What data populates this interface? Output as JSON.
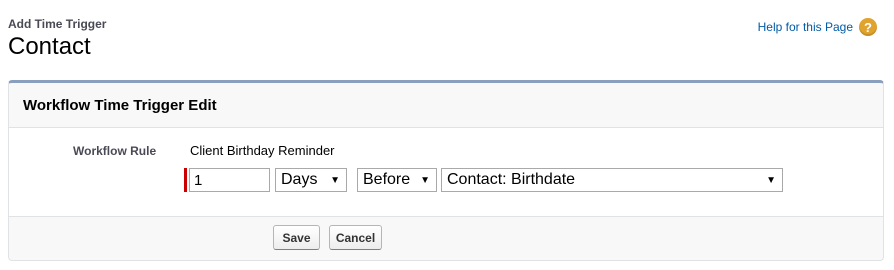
{
  "header": {
    "subtitle": "Add Time Trigger",
    "title": "Contact"
  },
  "help": {
    "link_label": "Help for this Page",
    "icon_glyph": "?",
    "icon_color": "#e0a32e"
  },
  "panel": {
    "title": "Workflow Time Trigger Edit",
    "accent_color": "#8a9ebe"
  },
  "form": {
    "rule_label": "Workflow Rule",
    "rule_value": "Client Birthday Reminder",
    "offset_value": "1",
    "units_selected": "Days",
    "direction_selected": "Before",
    "date_field_selected": "Contact: Birthdate",
    "required_color": "#cc0000"
  },
  "buttons": {
    "save_label": "Save",
    "cancel_label": "Cancel"
  }
}
